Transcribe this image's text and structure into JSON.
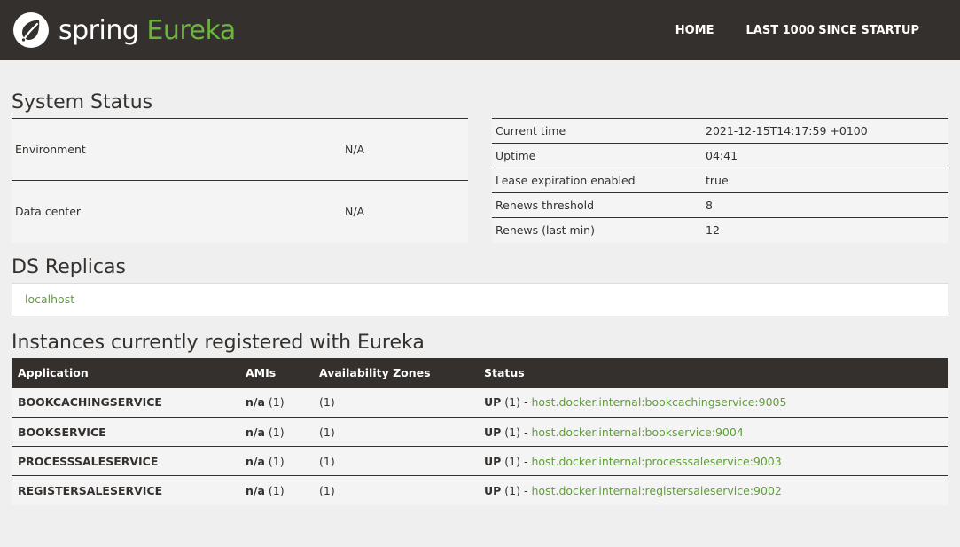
{
  "navbar": {
    "brand_spring": "spring",
    "brand_eureka": "Eureka",
    "links": [
      {
        "label": "HOME"
      },
      {
        "label": "LAST 1000 SINCE STARTUP"
      }
    ]
  },
  "system_status": {
    "title": "System Status",
    "left": [
      {
        "key": "Environment",
        "value": "N/A"
      },
      {
        "key": "Data center",
        "value": "N/A"
      }
    ],
    "right": [
      {
        "key": "Current time",
        "value": "2021-12-15T14:17:59 +0100"
      },
      {
        "key": "Uptime",
        "value": "04:41"
      },
      {
        "key": "Lease expiration enabled",
        "value": "true"
      },
      {
        "key": "Renews threshold",
        "value": "8"
      },
      {
        "key": "Renews (last min)",
        "value": "12"
      }
    ]
  },
  "ds_replicas": {
    "title": "DS Replicas",
    "items": [
      "localhost"
    ]
  },
  "instances": {
    "title": "Instances currently registered with Eureka",
    "headers": [
      "Application",
      "AMIs",
      "Availability Zones",
      "Status"
    ],
    "rows": [
      {
        "app": "BOOKCACHINGSERVICE",
        "ami_label": "n/a",
        "ami_count": "(1)",
        "zones": "(1)",
        "status": "UP",
        "status_count": "(1) -",
        "instance": "host.docker.internal:bookcachingservice:9005"
      },
      {
        "app": "BOOKSERVICE",
        "ami_label": "n/a",
        "ami_count": "(1)",
        "zones": "(1)",
        "status": "UP",
        "status_count": "(1) -",
        "instance": "host.docker.internal:bookservice:9004"
      },
      {
        "app": "PROCESSSALESERVICE",
        "ami_label": "n/a",
        "ami_count": "(1)",
        "zones": "(1)",
        "status": "UP",
        "status_count": "(1) -",
        "instance": "host.docker.internal:processsaleservice:9003"
      },
      {
        "app": "REGISTERSALESERVICE",
        "ami_label": "n/a",
        "ami_count": "(1)",
        "zones": "(1)",
        "status": "UP",
        "status_count": "(1) -",
        "instance": "host.docker.internal:registersaleservice:9002"
      }
    ]
  },
  "colors": {
    "navbar_bg": "#34302d",
    "accent_green": "#6db33f",
    "link_green": "#5fa134",
    "page_bg": "#efefef"
  }
}
